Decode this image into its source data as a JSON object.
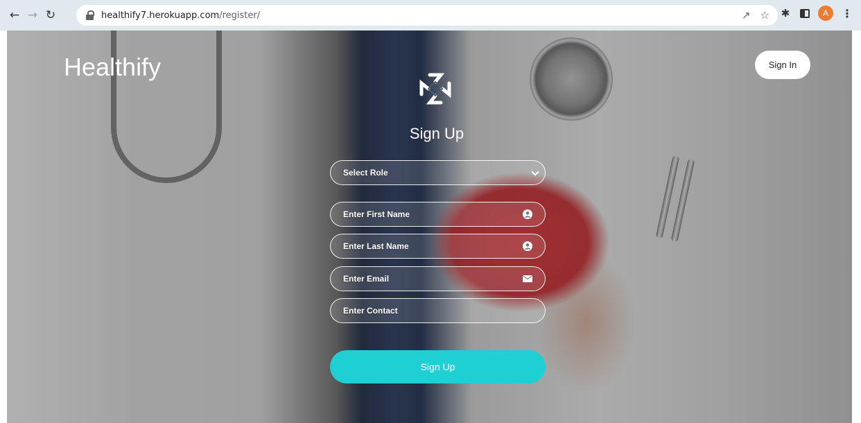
{
  "browser": {
    "url_host": "healthify7.herokuapp.com",
    "url_path": "/register/",
    "avatar_letter": "A"
  },
  "header": {
    "brand": "Healthify",
    "signin_label": "Sign In"
  },
  "form": {
    "title": "Sign Up",
    "role_select": "Select Role",
    "first_name_placeholder": "Enter First Name",
    "last_name_placeholder": "Enter Last Name",
    "email_placeholder": "Enter Email",
    "contact_placeholder": "Enter Contact",
    "submit_label": "Sign Up"
  },
  "colors": {
    "accent": "#1ecfd4",
    "avatar": "#f07a2e"
  }
}
